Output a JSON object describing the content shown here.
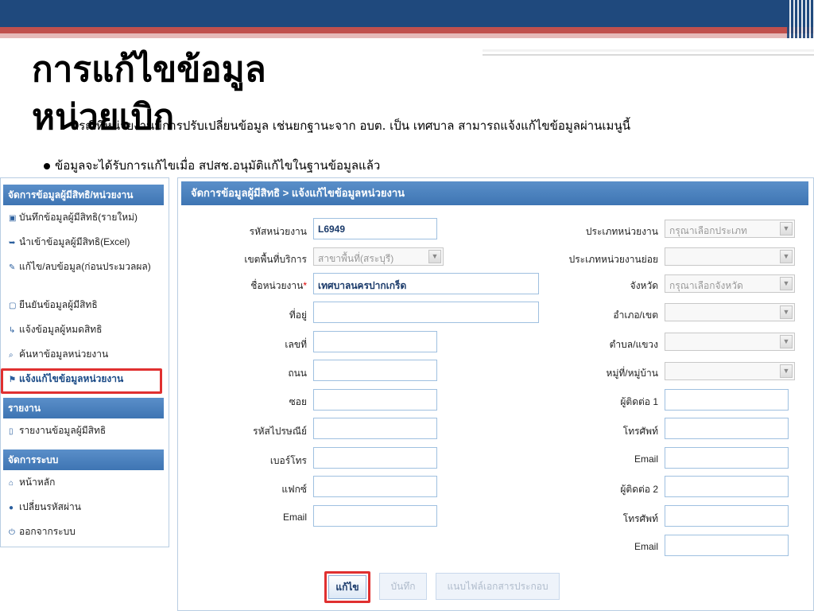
{
  "slide": {
    "title_line1": "การแก้ไขข้อมูล",
    "title_line2": "หน่วยเบิก",
    "bullet1": "กรณีที่หน่วยงานมีการปรับเปลี่ยนข้อมูล เช่นยกฐานะจาก อบต. เป็น เทศบาล สามารถแจ้งแก้ไขข้อมูลผ่านเมนูนี้",
    "bullet2": "ข้อมูลจะได้รับการแก้ไขเมื่อ สปสช.อนุมัติแก้ไขในฐานข้อมูลแล้ว"
  },
  "sidebar": {
    "section1": "จัดการข้อมูลผู้มีสิทธิ/หน่วยงาน",
    "items1": [
      {
        "label": "บันทึกข้อมูลผู้มีสิทธิ(รายใหม่)",
        "icon": "save-icon"
      },
      {
        "label": "นำเข้าข้อมูลผู้มีสิทธิ(Excel)",
        "icon": "import-icon"
      },
      {
        "label": "แก้ไข/ลบข้อมูล(ก่อนประมวลผล)",
        "icon": "wrench-icon"
      },
      {
        "label": "ยืนยันข้อมูลผู้มีสิทธิ",
        "icon": "document-icon"
      },
      {
        "label": "แจ้งข้อมูลผู้หมดสิทธิ",
        "icon": "notify-icon"
      },
      {
        "label": "ค้นหาข้อมูลหน่วยงาน",
        "icon": "search-icon"
      },
      {
        "label": "แจ้งแก้ไขข้อมูลหน่วยงาน",
        "icon": "flag-icon"
      }
    ],
    "section2": "รายงาน",
    "items2": [
      {
        "label": "รายงานข้อมูลผู้มีสิทธิ",
        "icon": "report-icon"
      }
    ],
    "section3": "จัดการระบบ",
    "items3": [
      {
        "label": "หน้าหลัก",
        "icon": "home-icon"
      },
      {
        "label": "เปลี่ยนรหัสผ่าน",
        "icon": "lock-icon"
      },
      {
        "label": "ออกจากระบบ",
        "icon": "power-icon"
      }
    ]
  },
  "form": {
    "header": "จัดการข้อมูลผู้มีสิทธิ > แจ้งแก้ไขข้อมูลหน่วยงาน",
    "left": {
      "unit_code_label": "รหัสหน่วยงาน",
      "unit_code_value": "L6949",
      "service_area_label": "เขตพื้นที่บริการ",
      "service_area_value": "สาขาพื้นที่(สระบุรี)",
      "unit_name_label": "ชื่อหน่วยงาน",
      "required_mark": "*",
      "unit_name_value": "เทศบาลนครปากเกร็ด",
      "address_label": "ที่อยู่",
      "number_label": "เลขที่",
      "road_label": "ถนน",
      "soi_label": "ซอย",
      "postcode_label": "รหัสไปรษณีย์",
      "phone_label": "เบอร์โทร",
      "fax_label": "แฟกซ์",
      "email_label": "Email"
    },
    "right": {
      "unit_type_label": "ประเภทหน่วยงาน",
      "unit_type_placeholder": "กรุณาเลือกประเภท",
      "unit_subtype_label": "ประเภทหน่วยงานย่อย",
      "province_label": "จังหวัด",
      "province_placeholder": "กรุณาเลือกจังหวัด",
      "district_label": "อำเภอ/เขต",
      "subdistrict_label": "ตำบล/แขวง",
      "village_label": "หมู่ที่/หมู่บ้าน",
      "contact1_label": "ผู้ติดต่อ 1",
      "phone1_label": "โทรศัพท์",
      "email1_label": "Email",
      "contact2_label": "ผู้ติดต่อ 2",
      "phone2_label": "โทรศัพท์",
      "email2_label": "Email"
    },
    "buttons": {
      "edit": "แก้ไข",
      "save": "บันทึก",
      "attach": "แนบไฟล์เอกสารประกอบ"
    }
  }
}
